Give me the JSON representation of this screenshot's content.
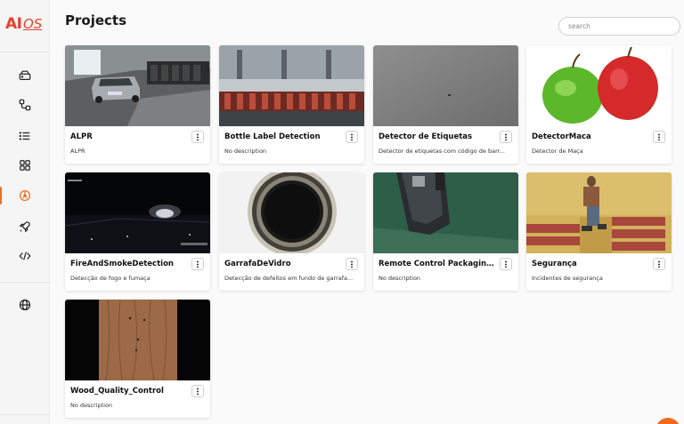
{
  "brand": {
    "logo_ai": "AI",
    "logo_os": "OS",
    "logo_sub": ""
  },
  "header": {
    "title": "Projects"
  },
  "search": {
    "placeholder": "search"
  },
  "sidebar": {
    "items": [
      {
        "icon": "drive-icon",
        "label": "Storage"
      },
      {
        "icon": "flow-icon",
        "label": "Pipelines"
      },
      {
        "icon": "list-icon",
        "label": "Lists"
      },
      {
        "icon": "grid-icon",
        "label": "Apps"
      },
      {
        "icon": "projects-icon",
        "label": "Projects",
        "active": true
      },
      {
        "icon": "rocket-icon",
        "label": "Deploy"
      },
      {
        "icon": "code-icon",
        "label": "Code"
      },
      {
        "icon": "globe-icon",
        "label": "Web"
      }
    ]
  },
  "projects": [
    {
      "title": "ALPR",
      "description": "ALPR",
      "thumbnail": "parking-garage-car"
    },
    {
      "title": "Bottle Label Detection",
      "description": "No description",
      "thumbnail": "bottle-production-line"
    },
    {
      "title": "Detector de Etiquetas",
      "description": "Detector de etiquetas com código de barr...",
      "thumbnail": "gray-surface"
    },
    {
      "title": "DetectorMaca",
      "description": "Detector de Maça",
      "thumbnail": "apples"
    },
    {
      "title": "FireAndSmokeDetection",
      "description": "Detecção de fogo e fumaça",
      "thumbnail": "night-camera-fire"
    },
    {
      "title": "GarrafaDeVidro",
      "description": "Detecção de defeitos em fundo de garrafa...",
      "thumbnail": "glass-bottle-bottom"
    },
    {
      "title": "Remote Control Packaging De...",
      "description": "No description",
      "thumbnail": "remote-control-green"
    },
    {
      "title": "Segurança",
      "description": "Incidentes de segurança",
      "thumbnail": "worker-pallets"
    },
    {
      "title": "Wood_Quality_Control",
      "description": "No description",
      "thumbnail": "wood-plank"
    }
  ],
  "colors": {
    "accent": "#f06a1f",
    "logo": "#e8412c"
  }
}
